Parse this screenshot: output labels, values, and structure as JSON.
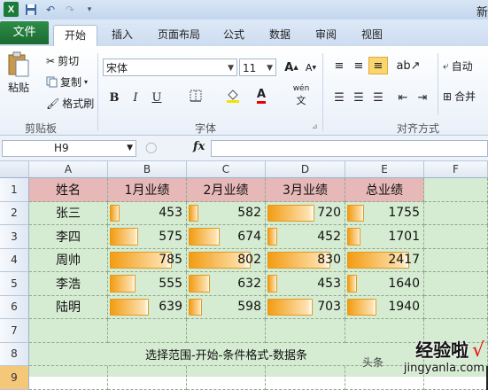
{
  "title": "新",
  "qat": {
    "logo": "X",
    "icons": [
      "save-icon",
      "undo-icon",
      "redo-icon",
      "customize-icon"
    ]
  },
  "tabs": [
    "文件",
    "开始",
    "插入",
    "页面布局",
    "公式",
    "数据",
    "审阅",
    "视图"
  ],
  "ribbon": {
    "clipboard": {
      "paste": "粘贴",
      "cut": "剪切",
      "copy": "复制",
      "format_painter": "格式刷",
      "label": "剪贴板"
    },
    "font": {
      "name": "宋体",
      "size": "11",
      "bold": "B",
      "italic": "I",
      "underline": "U",
      "grow": "A",
      "shrink": "A",
      "color_a": "A",
      "phonetic": "wén",
      "label": "字体"
    },
    "alignment": {
      "wrap": "自动",
      "merge": "合并",
      "label": "对齐方式"
    }
  },
  "formula_bar": {
    "name_box": "H9",
    "fx": "fx",
    "value": ""
  },
  "columns": [
    "A",
    "B",
    "C",
    "D",
    "E",
    "F"
  ],
  "rows": [
    "1",
    "2",
    "3",
    "4",
    "5",
    "6",
    "7",
    "8",
    "9"
  ],
  "table": {
    "headers": [
      "姓名",
      "1月业绩",
      "2月业绩",
      "3月业绩",
      "总业绩"
    ],
    "rows": [
      [
        "张三",
        "453",
        "582",
        "720",
        "1755"
      ],
      [
        "李四",
        "575",
        "674",
        "452",
        "1701"
      ],
      [
        "周帅",
        "785",
        "802",
        "830",
        "2417"
      ],
      [
        "李浩",
        "555",
        "632",
        "453",
        "1640"
      ],
      [
        "陆明",
        "639",
        "598",
        "703",
        "1940"
      ]
    ]
  },
  "note": "选择范围-开始-条件格式-数据条",
  "watermark": {
    "main": "经验啦",
    "check": "√",
    "url": "jingyanla.com",
    "small": "头条"
  },
  "colors": {
    "header_fill": "#e6b8b7",
    "sheet_fill": "#d5ecd2",
    "databar": "#f39c12",
    "file_tab": "#1f7a3a"
  }
}
